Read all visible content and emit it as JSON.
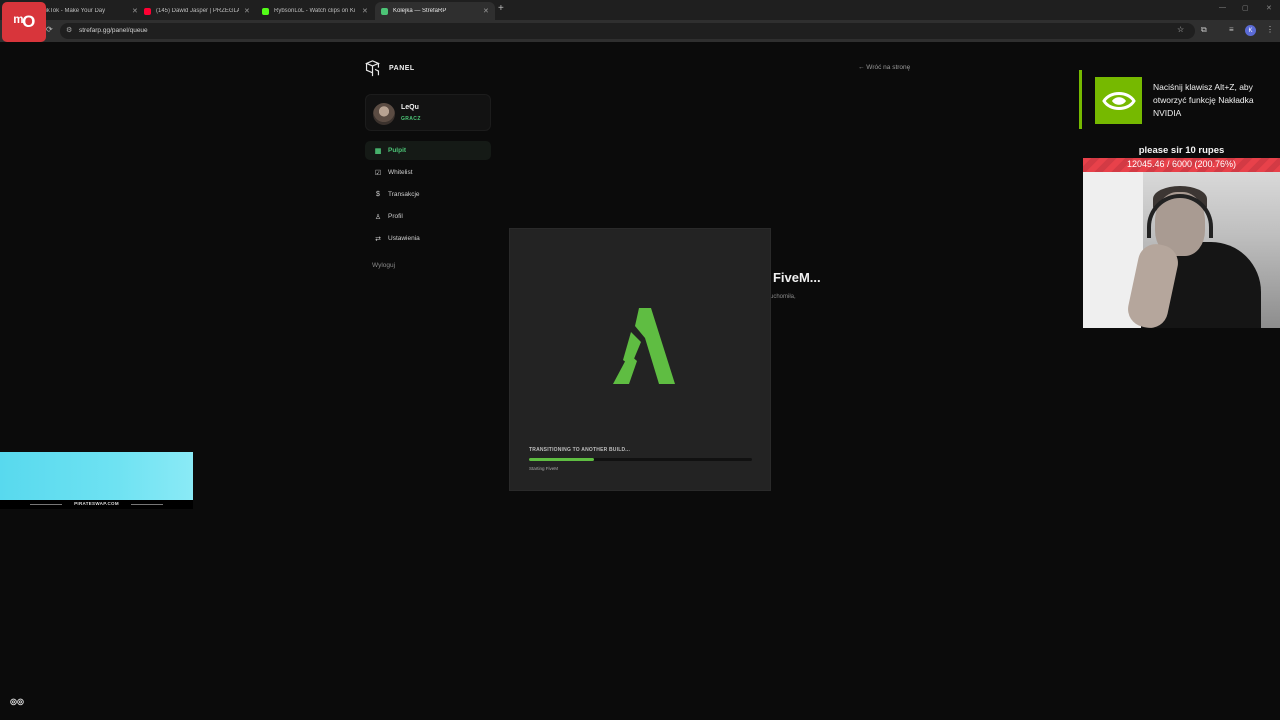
{
  "browser": {
    "tabs": [
      {
        "label": "TikTok - Make Your Day",
        "color": "#111111",
        "active": false
      },
      {
        "label": "(145) Dawid Jasper | PRZEGLĄD",
        "color": "#ff0033",
        "active": false
      },
      {
        "label": "RybsonLoL - Watch clips on Ki",
        "color": "#53fc18",
        "active": false
      },
      {
        "label": "Kolejka — StrefaRP",
        "color": "#4cc476",
        "active": true
      }
    ],
    "url": "strefarp.gg/panel/queue",
    "profile_initial": "K"
  },
  "stream_logo": "ᵐO",
  "page": {
    "brand": "PANEL",
    "back_link": "← Wróć na stronę",
    "user": {
      "name": "LeQu",
      "role": "GRACZ"
    },
    "nav": [
      {
        "label": "Pulpit",
        "icon": "dashboard-icon",
        "active": true
      },
      {
        "label": "Whitelist",
        "icon": "checkbox-icon",
        "active": false
      },
      {
        "label": "Transakcje",
        "icon": "dollar-icon",
        "active": false
      },
      {
        "label": "Profil",
        "icon": "user-icon",
        "active": false
      },
      {
        "label": "Ustawienia",
        "icon": "sliders-icon",
        "active": false
      }
    ],
    "logout": "Wyloguj",
    "background_heading": ": FiveM...",
    "background_sub": "uchomiła,"
  },
  "loader": {
    "title": "TRANSITIONING TO ANOTHER BUILD...",
    "subtitle": "Starting FiveM",
    "progress_percent": 29,
    "accent": "#5fbd42"
  },
  "overlays": {
    "nvidia_text": "Naciśnij klawisz Alt+Z, aby otworzyć funkcję Nakładka NVIDIA",
    "donation_title": "please sir 10 rupes",
    "donation_progress": "12045.46 / 6000 (200.76%)",
    "ad_text": "PIRATESWAP.COM"
  }
}
